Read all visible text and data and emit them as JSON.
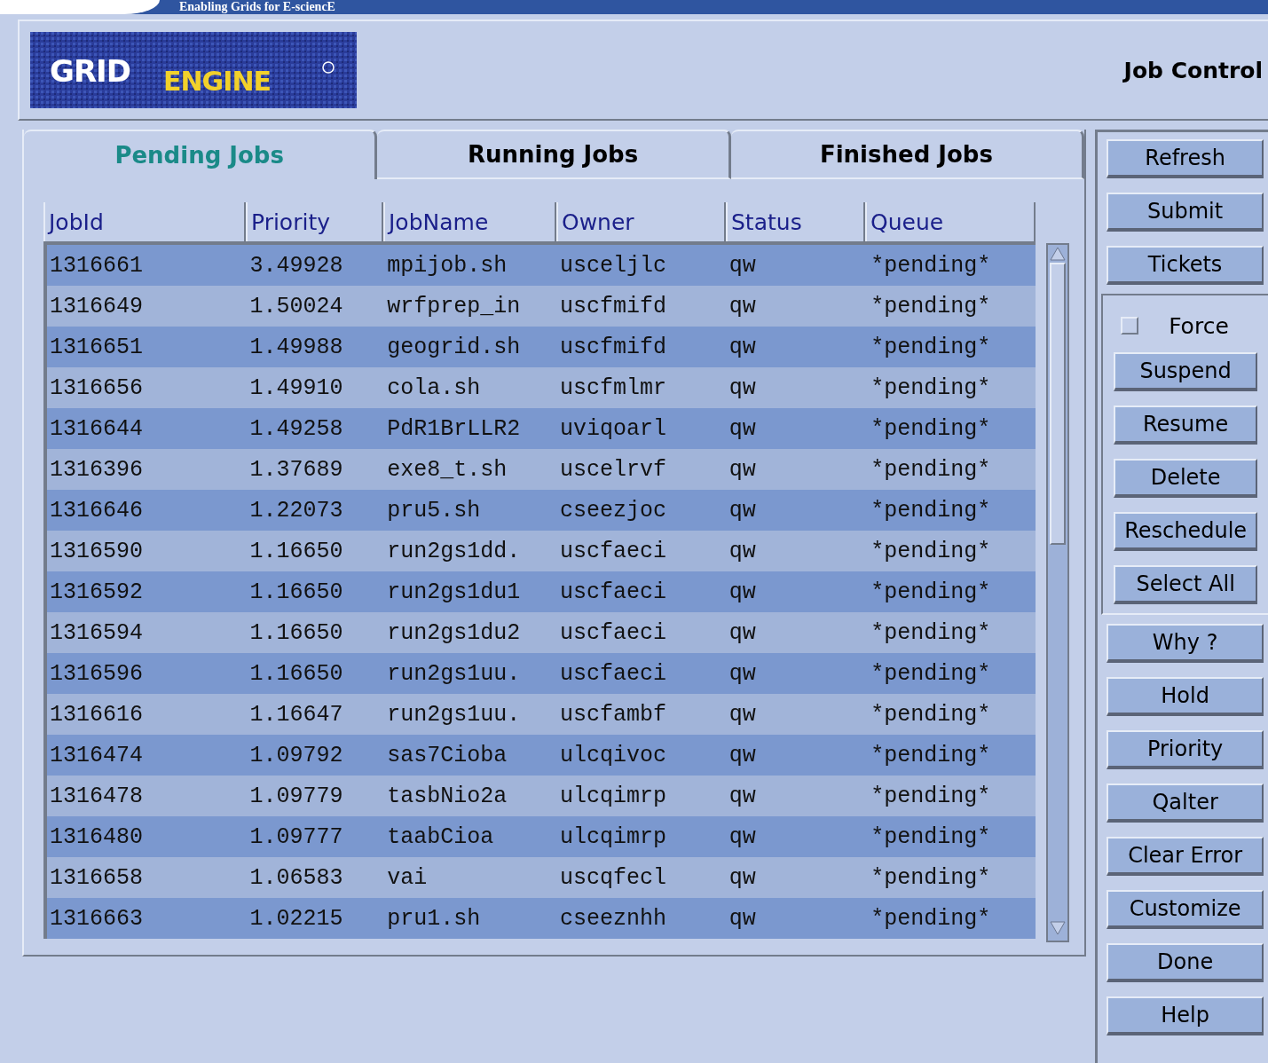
{
  "banner": {
    "title": "Enabling Grids for E-sciencE"
  },
  "logo": {
    "word1": "GRID",
    "word2": "ENGINE"
  },
  "window": {
    "title": "Job Control"
  },
  "tabs": [
    {
      "label": "Pending Jobs",
      "selected": true
    },
    {
      "label": "Running Jobs",
      "selected": false
    },
    {
      "label": "Finished Jobs",
      "selected": false
    }
  ],
  "table": {
    "columns": [
      "JobId",
      "Priority",
      "JobName",
      "Owner",
      "Status",
      "Queue"
    ],
    "rows": [
      [
        "1316661",
        "3.49928",
        "mpijob.sh",
        "usceljlc",
        "qw",
        "*pending*"
      ],
      [
        "1316649",
        "1.50024",
        "wrfprep_in",
        "uscfmifd",
        "qw",
        "*pending*"
      ],
      [
        "1316651",
        "1.49988",
        "geogrid.sh",
        "uscfmifd",
        "qw",
        "*pending*"
      ],
      [
        "1316656",
        "1.49910",
        "cola.sh",
        "uscfmlmr",
        "qw",
        "*pending*"
      ],
      [
        "1316644",
        "1.49258",
        "PdR1BrLLR2",
        "uviqoarl",
        "qw",
        "*pending*"
      ],
      [
        "1316396",
        "1.37689",
        "exe8_t.sh",
        "uscelrvf",
        "qw",
        "*pending*"
      ],
      [
        "1316646",
        "1.22073",
        "pru5.sh",
        "cseezjoc",
        "qw",
        "*pending*"
      ],
      [
        "1316590",
        "1.16650",
        "run2gs1dd.",
        "uscfaeci",
        "qw",
        "*pending*"
      ],
      [
        "1316592",
        "1.16650",
        "run2gs1du1",
        "uscfaeci",
        "qw",
        "*pending*"
      ],
      [
        "1316594",
        "1.16650",
        "run2gs1du2",
        "uscfaeci",
        "qw",
        "*pending*"
      ],
      [
        "1316596",
        "1.16650",
        "run2gs1uu.",
        "uscfaeci",
        "qw",
        "*pending*"
      ],
      [
        "1316616",
        "1.16647",
        "run2gs1uu.",
        "uscfambf",
        "qw",
        "*pending*"
      ],
      [
        "1316474",
        "1.09792",
        "sas7Cioba",
        "ulcqivoc",
        "qw",
        "*pending*"
      ],
      [
        "1316478",
        "1.09779",
        "tasbNio2a",
        "ulcqimrp",
        "qw",
        "*pending*"
      ],
      [
        "1316480",
        "1.09777",
        "taabCioa",
        "ulcqimrp",
        "qw",
        "*pending*"
      ],
      [
        "1316658",
        "1.06583",
        "vai",
        "uscqfecl",
        "qw",
        "*pending*"
      ],
      [
        "1316663",
        "1.02215",
        "pru1.sh",
        "cseeznhh",
        "qw",
        "*pending*"
      ]
    ]
  },
  "top_buttons": [
    "Refresh",
    "Submit",
    "Tickets"
  ],
  "force": {
    "label": "Force",
    "checked": false
  },
  "action_buttons": [
    "Suspend",
    "Resume",
    "Delete",
    "Reschedule",
    "Select All"
  ],
  "bottom_buttons": [
    "Why ?",
    "Hold",
    "Priority",
    "Qalter",
    "Clear Error",
    "Customize",
    "Done",
    "Help"
  ]
}
